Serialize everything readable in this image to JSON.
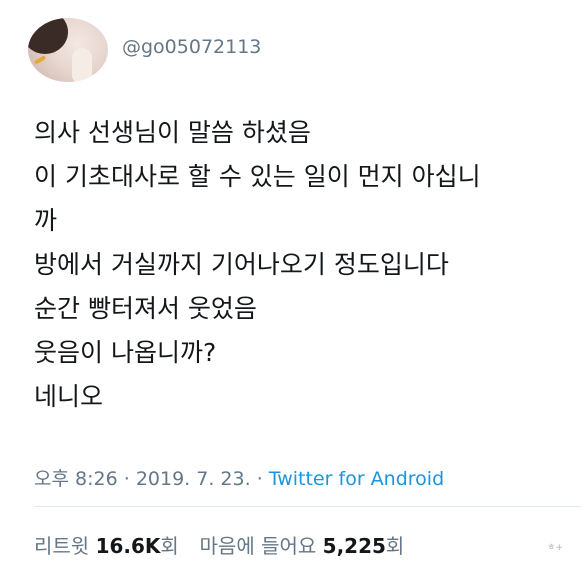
{
  "tweet": {
    "handle": "@go05072113",
    "lines": [
      "의사 선생님이 말씀 하셨음",
      "이 기초대사로 할 수 있는 일이 먼지 아십니",
      "까",
      "방에서 거실까지 기어나오기 정도입니다",
      "순간 빵터져서 웃었음",
      "웃음이 나옵니까?",
      "네니오"
    ],
    "time": "오후 8:26",
    "separator_1": "·",
    "date": "2019. 7. 23.",
    "separator_2": "·",
    "source": "Twitter for Android"
  },
  "stats": {
    "retweet_label": "리트윗",
    "retweet_count": "16.6K",
    "retweet_suffix": "회",
    "like_label": "마음에 들어요",
    "like_count": "5,225",
    "like_suffix": "회"
  },
  "watermark": "ㅎ+",
  "colors": {
    "text": "#14171a",
    "secondary": "#657786",
    "link": "#1b95e0",
    "divider": "#e1e8ed"
  }
}
